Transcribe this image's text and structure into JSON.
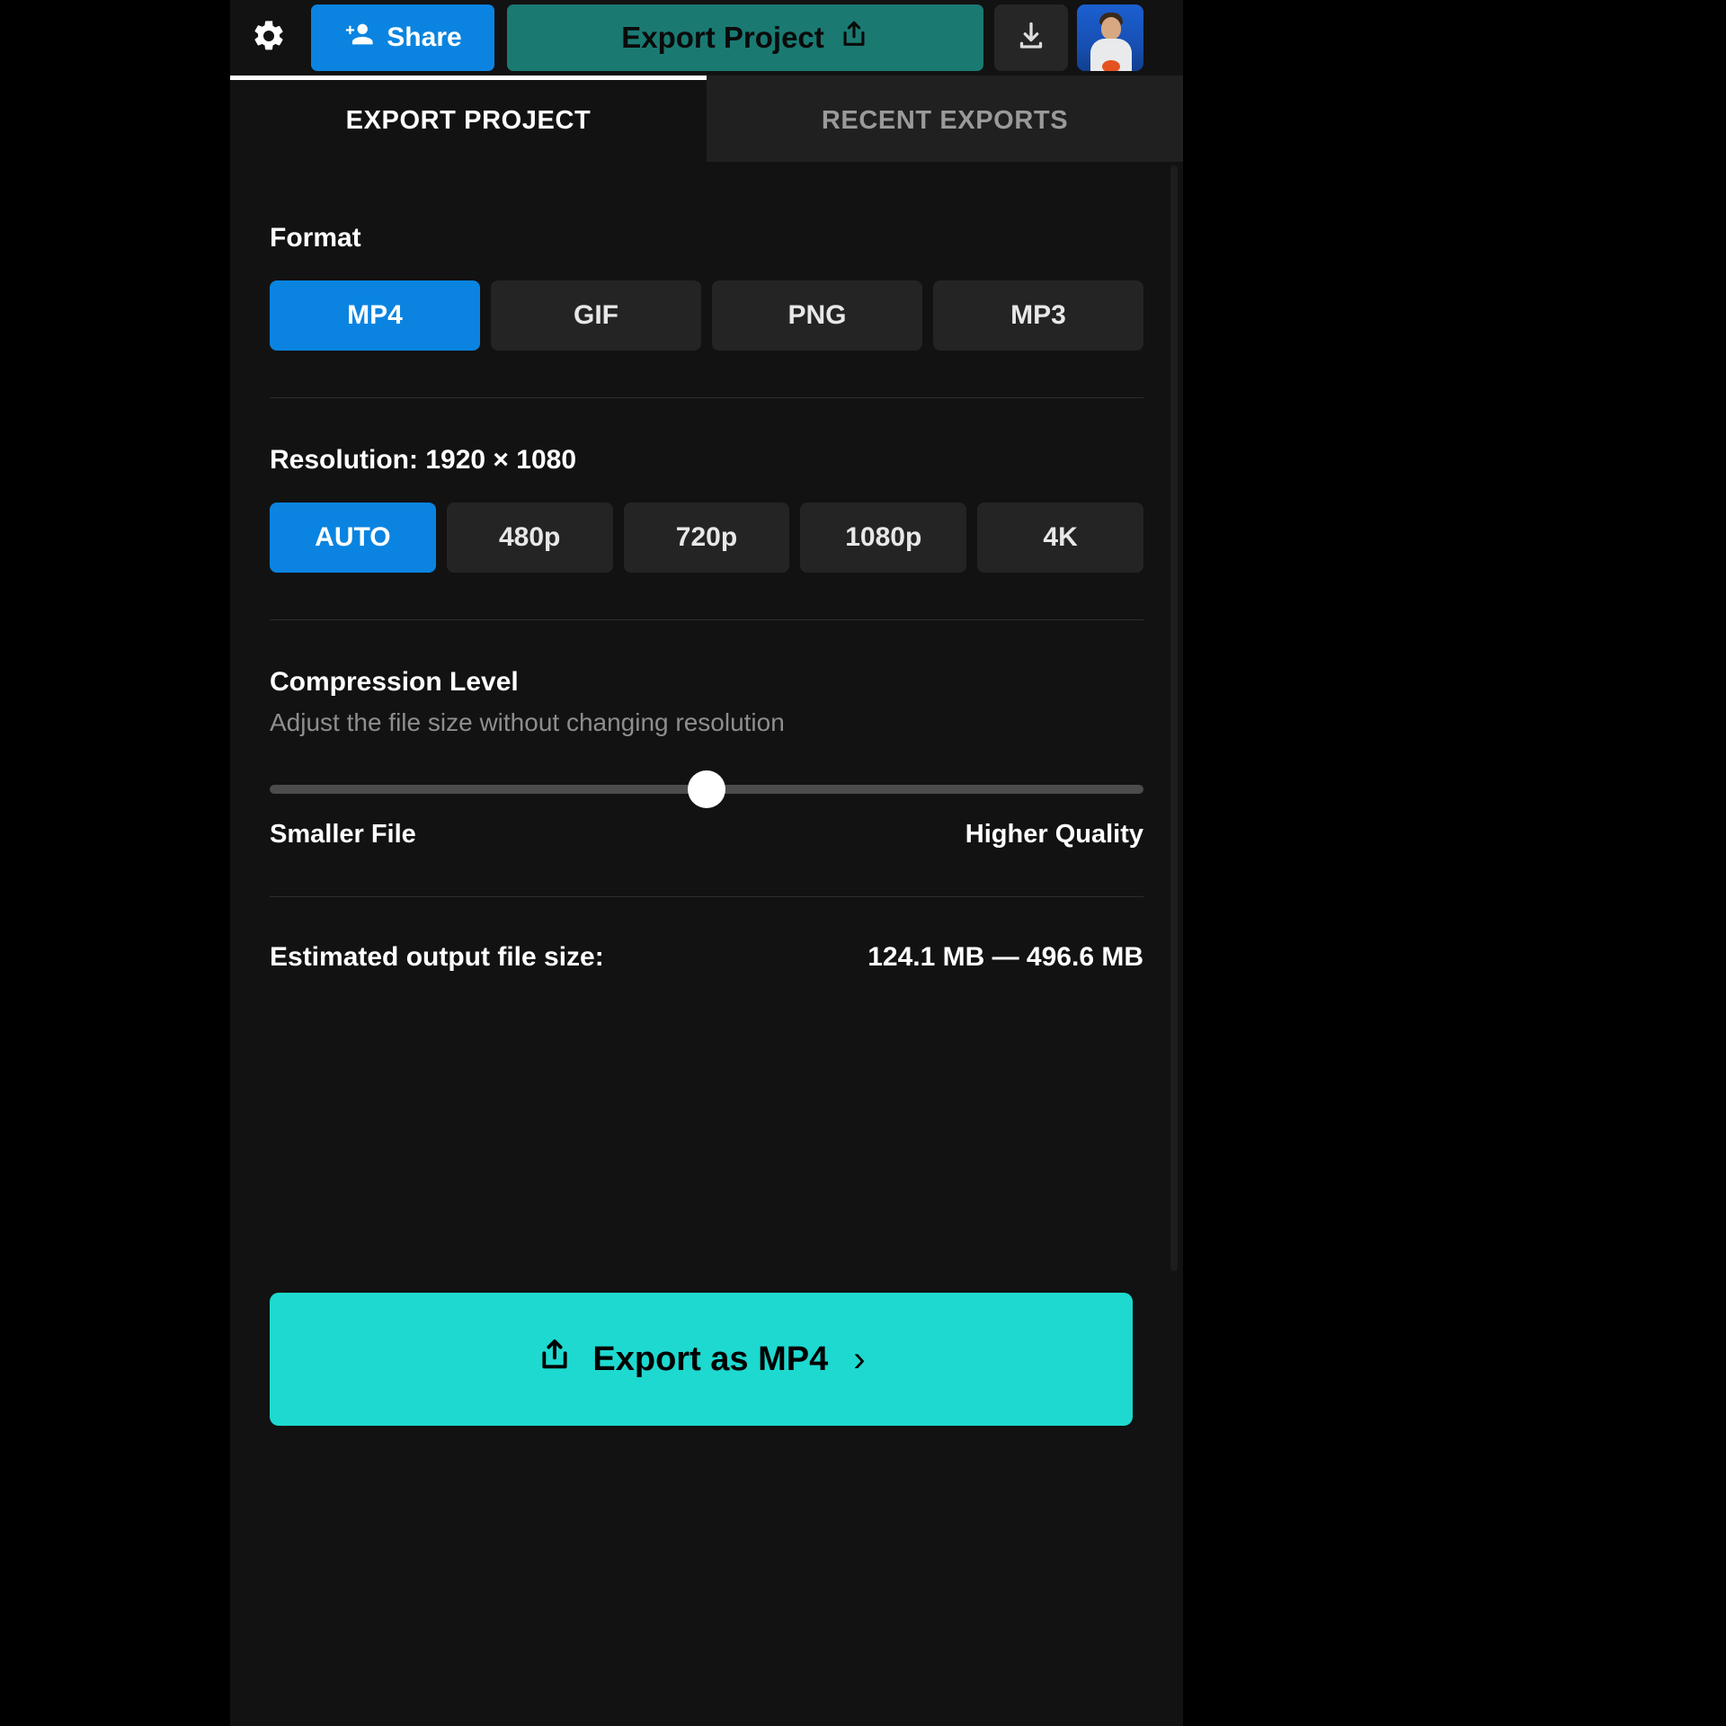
{
  "toolbar": {
    "gear_icon": "gear-icon",
    "share_label": "Share",
    "share_icon": "person-add-icon",
    "export_project_label": "Export Project",
    "export_project_icon": "share-up-icon",
    "download_icon": "download-icon",
    "avatar_alt": "user-avatar"
  },
  "tabs": [
    {
      "label": "EXPORT PROJECT",
      "active": true
    },
    {
      "label": "RECENT EXPORTS",
      "active": false
    }
  ],
  "format": {
    "label": "Format",
    "options": [
      "MP4",
      "GIF",
      "PNG",
      "MP3"
    ],
    "selected": "MP4"
  },
  "resolution": {
    "label": "Resolution:",
    "value": "1920 × 1080",
    "options": [
      "AUTO",
      "480p",
      "720p",
      "1080p",
      "4K"
    ],
    "selected": "AUTO"
  },
  "compression": {
    "label": "Compression Level",
    "description": "Adjust the file size without changing resolution",
    "slider_percent": 50,
    "min_label": "Smaller File",
    "max_label": "Higher Quality"
  },
  "estimate": {
    "label": "Estimated output file size:",
    "value": "124.1 MB — 496.6 MB"
  },
  "cta": {
    "label": "Export as MP4",
    "icon": "share-up-icon",
    "chevron": "›"
  },
  "colors": {
    "accent_blue": "#0a84e0",
    "accent_teal": "#1a7a72",
    "accent_cyan": "#1ed9d0",
    "panel_bg": "#121212",
    "button_bg": "#242424"
  }
}
